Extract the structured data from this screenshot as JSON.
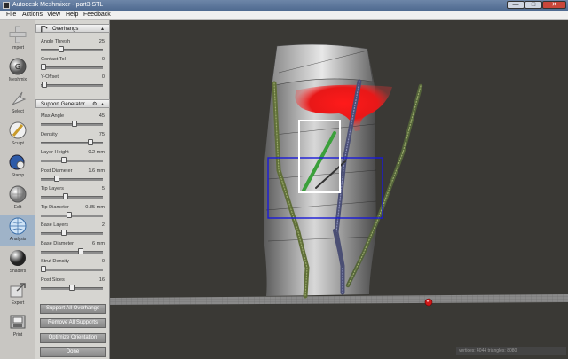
{
  "window": {
    "title": "Autodesk Meshmixer - part3.STL",
    "min_glyph": "—",
    "max_glyph": "□",
    "close_glyph": "✕"
  },
  "menu": [
    "File",
    "Actions",
    "View",
    "Help",
    "Feedback"
  ],
  "tools": [
    {
      "label": "Import",
      "icon": "plus-icon"
    },
    {
      "label": "Meshmix",
      "icon": "meshmix-ball-icon"
    },
    {
      "label": "Select",
      "icon": "select-arrow-icon"
    },
    {
      "label": "Sculpt",
      "icon": "sculpt-brush-icon"
    },
    {
      "label": "Stamp",
      "icon": "stamp-icon"
    },
    {
      "label": "Edit",
      "icon": "edit-sphere-icon"
    },
    {
      "label": "Analysis",
      "icon": "analysis-sphere-icon"
    },
    {
      "label": "Shaders",
      "icon": "shader-sphere-icon"
    },
    {
      "label": "Export",
      "icon": "export-icon"
    },
    {
      "label": "Print",
      "icon": "print-icon"
    }
  ],
  "active_tool": "Analysis",
  "overhangs": {
    "title": "Overhangs",
    "toggle": "▴",
    "params": [
      {
        "label": "Angle Thresh",
        "value": "25",
        "fraction": 0.28
      },
      {
        "label": "Contact Tol",
        "value": "0",
        "fraction": 0.0
      },
      {
        "label": "Y-Offset",
        "value": "0",
        "fraction": 0.02
      }
    ]
  },
  "support": {
    "title": "Support Generator",
    "settings_icon": "⚙",
    "toggle": "▴",
    "params": [
      {
        "label": "Max Angle",
        "value": "45",
        "fraction": 0.5
      },
      {
        "label": "Density",
        "value": "75",
        "fraction": 0.75
      },
      {
        "label": "Layer Height",
        "value": "0.2  mm",
        "fraction": 0.33
      },
      {
        "label": "Post Diameter",
        "value": "1.6  mm",
        "fraction": 0.22
      },
      {
        "label": "Tip Layers",
        "value": "5",
        "fraction": 0.35
      },
      {
        "label": "Tip Diameter",
        "value": "0.85  mm",
        "fraction": 0.42
      },
      {
        "label": "Base Layers",
        "value": "2",
        "fraction": 0.33
      },
      {
        "label": "Base Diameter",
        "value": "6  mm",
        "fraction": 0.6
      },
      {
        "label": "Strut Density",
        "value": "0",
        "fraction": 0.0
      },
      {
        "label": "Post Sides",
        "value": "16",
        "fraction": 0.45
      }
    ],
    "buttons": [
      "Support All Overhangs",
      "Remove All Supports",
      "Optimize Orientation",
      "Done"
    ]
  },
  "status": {
    "text": "vertices: 4044 triangles: 8080"
  },
  "colors": {
    "overhang": "#ff2020",
    "selection": "#ffffff",
    "bbox": "#1a1ad8",
    "model": "#d6d6d6",
    "support": "#6a7a3a"
  }
}
